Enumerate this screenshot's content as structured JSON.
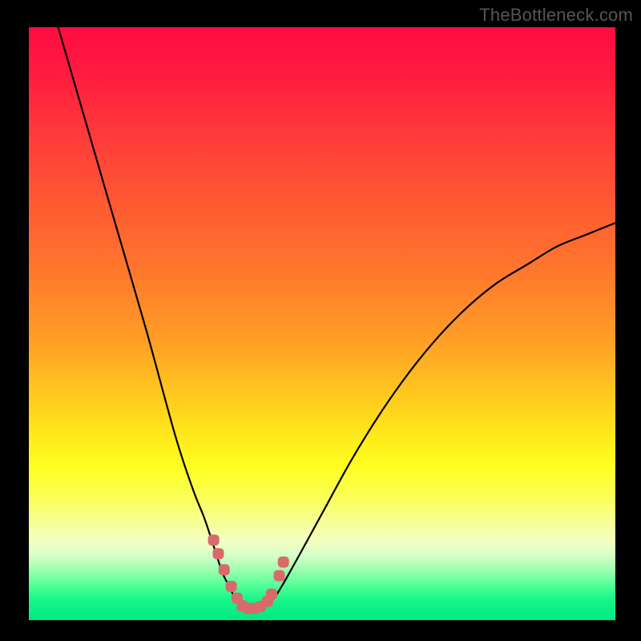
{
  "watermark": {
    "text": "TheBottleneck.com"
  },
  "colors": {
    "background": "#000000",
    "curve": "#000000",
    "marker": "#d96a6a",
    "gradient_top": "#ff0b42",
    "gradient_bottom": "#00e884"
  },
  "chart_data": {
    "type": "line",
    "title": "",
    "xlabel": "",
    "ylabel": "",
    "xlim": [
      0,
      100
    ],
    "ylim": [
      0,
      100
    ],
    "grid": false,
    "legend": false,
    "series": [
      {
        "name": "bottleneck-curve",
        "x": [
          5,
          10,
          15,
          20,
          25,
          28,
          30,
          32,
          33,
          34,
          35,
          36,
          37,
          38,
          39,
          40,
          42,
          45,
          50,
          55,
          60,
          65,
          70,
          75,
          80,
          85,
          90,
          95,
          100
        ],
        "y": [
          100,
          83,
          66,
          49,
          31,
          22,
          17,
          11,
          8,
          6,
          4,
          2.5,
          2,
          2,
          2,
          2.5,
          4,
          9,
          18,
          27,
          35,
          42,
          48,
          53,
          57,
          60,
          63,
          65,
          67
        ]
      }
    ],
    "markers": {
      "name": "highlight-dots",
      "x": [
        31.5,
        32.3,
        33.3,
        34.5,
        35.5,
        36.4,
        37.4,
        38.5,
        39.5,
        40.7,
        41.4,
        42.7,
        43.4
      ],
      "y": [
        13.5,
        11.2,
        8.5,
        5.7,
        3.7,
        2.4,
        2.0,
        2.0,
        2.3,
        3.2,
        4.4,
        7.5,
        9.8
      ]
    }
  }
}
